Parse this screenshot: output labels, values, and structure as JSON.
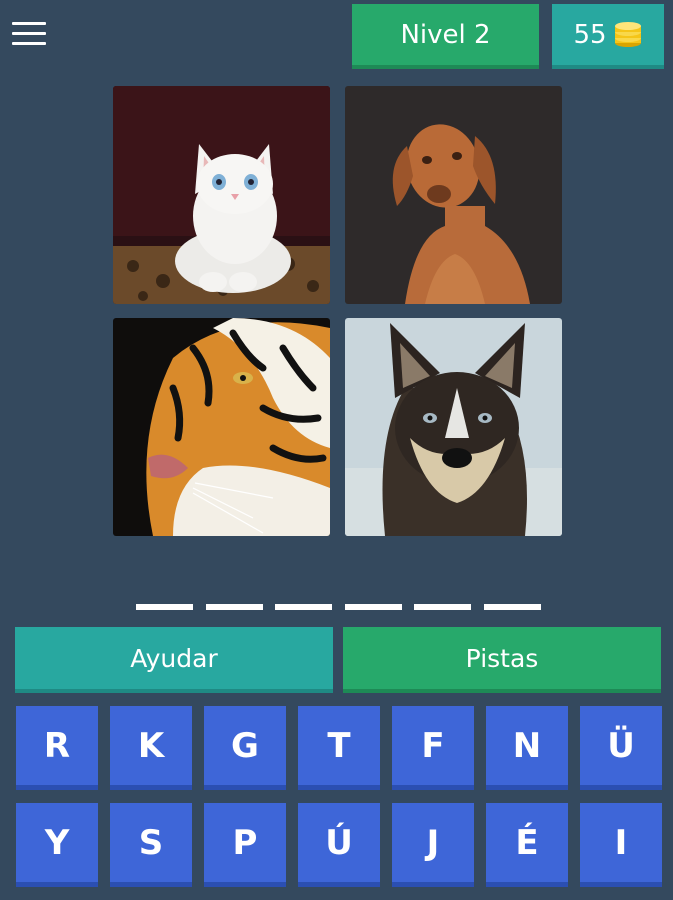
{
  "header": {
    "level_label": "Nivel 2",
    "coins": "55",
    "coin_icon": "coin-stack-icon",
    "menu_icon": "hamburger-menu-icon"
  },
  "images": [
    {
      "subject": "cat"
    },
    {
      "subject": "dog"
    },
    {
      "subject": "tiger"
    },
    {
      "subject": "wolf"
    }
  ],
  "answer": {
    "letter_count": 6
  },
  "actions": {
    "help_label": "Ayudar",
    "hints_label": "Pistas"
  },
  "keyboard": {
    "row1": [
      "R",
      "K",
      "G",
      "T",
      "F",
      "N",
      "Ü"
    ],
    "row2": [
      "Y",
      "S",
      "P",
      "Ú",
      "J",
      "É",
      "I"
    ]
  },
  "colors": {
    "background": "#34495e",
    "green": "#27a96b",
    "teal": "#28a8a0",
    "key_blue": "#3e66d8",
    "coin_gold": "#f5c518"
  }
}
